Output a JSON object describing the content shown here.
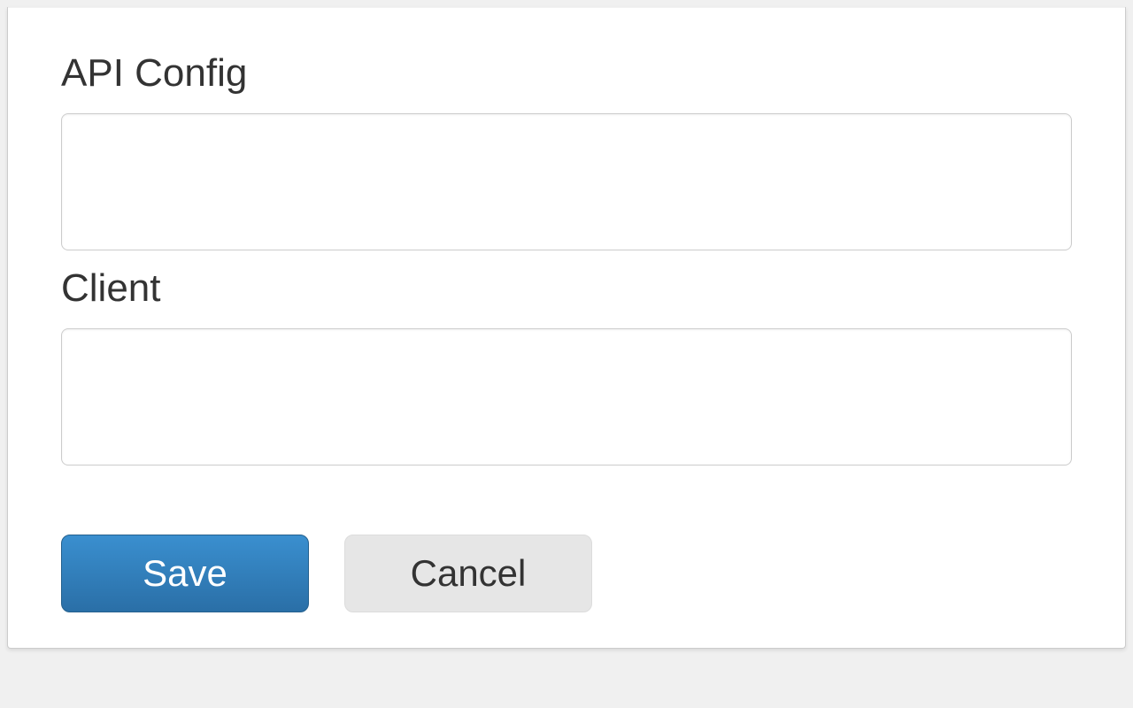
{
  "form": {
    "api_config_label": "API Config",
    "api_config_value": "",
    "client_label": "Client",
    "client_value": ""
  },
  "buttons": {
    "save_label": "Save",
    "cancel_label": "Cancel"
  }
}
